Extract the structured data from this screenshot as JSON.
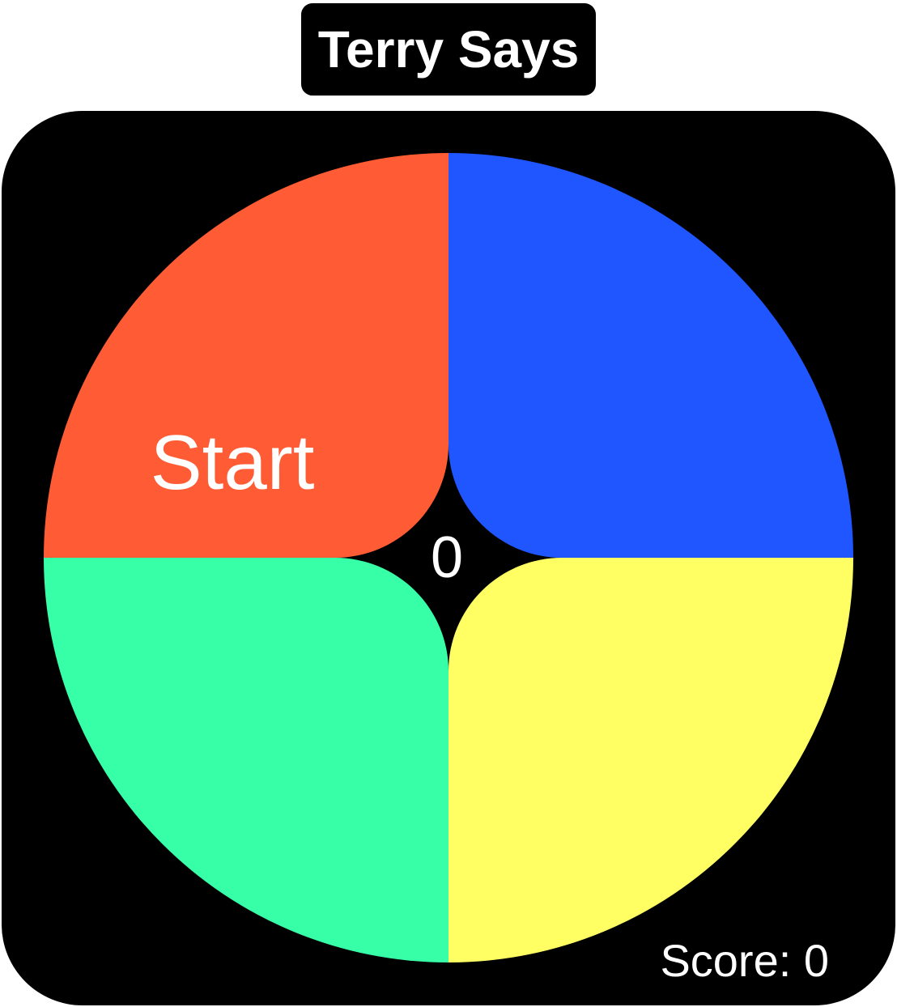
{
  "header": {
    "title": "Terry Says"
  },
  "game": {
    "start_label": "Start",
    "round_counter": "0",
    "score_label": "Score: 0",
    "pads": [
      {
        "name": "red",
        "color": "#FF5C36"
      },
      {
        "name": "blue",
        "color": "#1F56FF"
      },
      {
        "name": "green",
        "color": "#36FFA8"
      },
      {
        "name": "yellow",
        "color": "#FFFF63"
      }
    ],
    "board_color": "#000000",
    "text_color": "#FFFFFF"
  }
}
